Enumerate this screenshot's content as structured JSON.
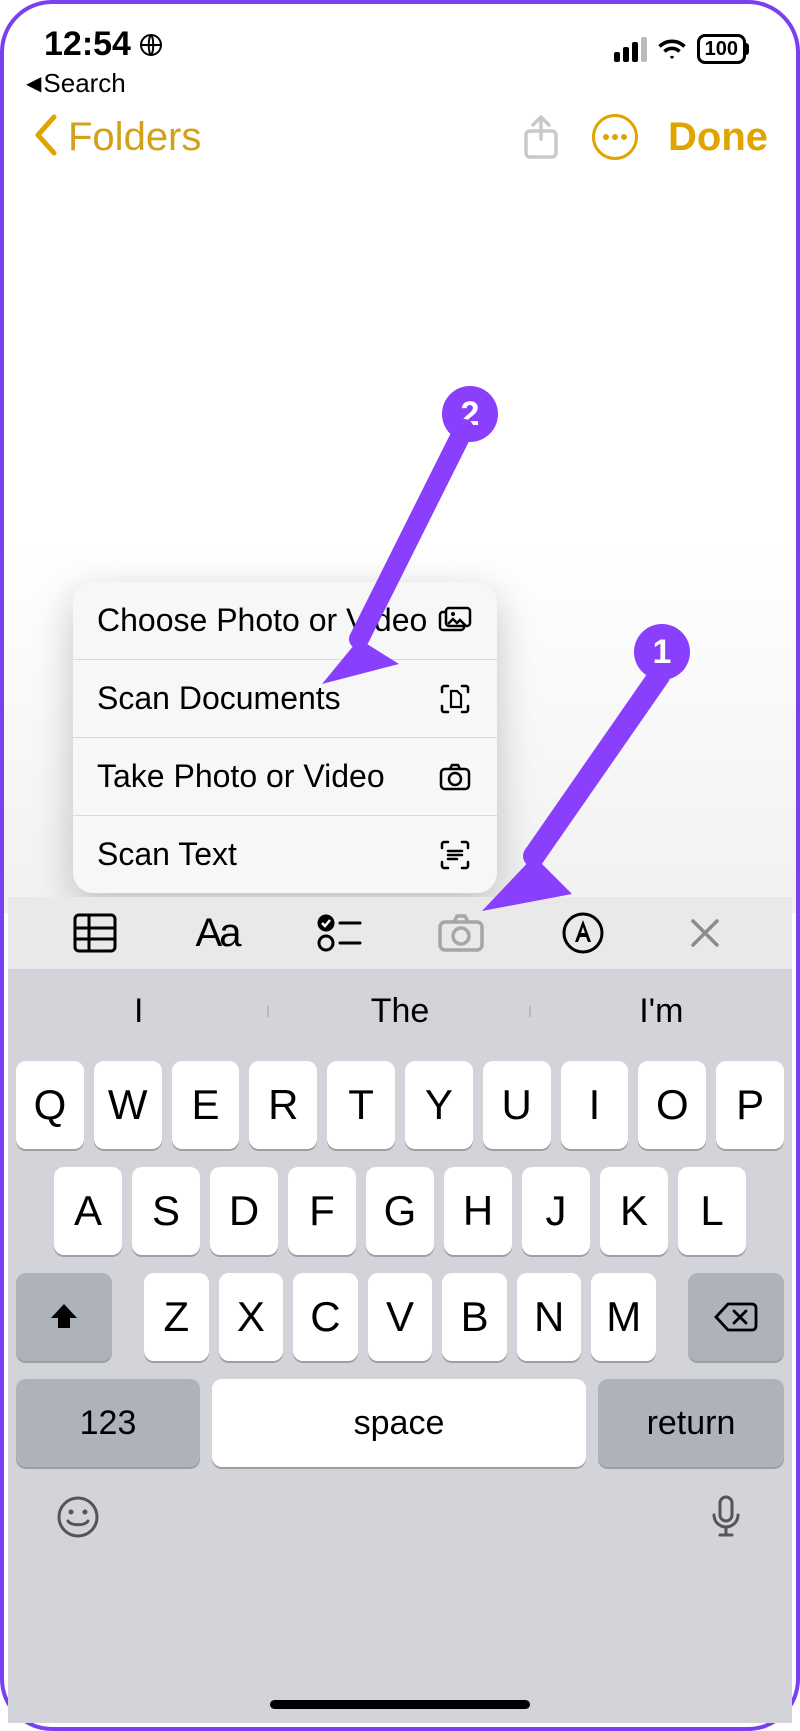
{
  "status": {
    "time": "12:54",
    "battery": "100"
  },
  "breadcrumb": {
    "label": "Search"
  },
  "nav": {
    "back_label": "Folders",
    "done_label": "Done"
  },
  "menu": {
    "items": [
      {
        "label": "Choose Photo or Video"
      },
      {
        "label": "Scan Documents"
      },
      {
        "label": "Take Photo or Video"
      },
      {
        "label": "Scan Text"
      }
    ]
  },
  "format_bar": {
    "aa": "Aa"
  },
  "predictions": [
    "I",
    "The",
    "I'm"
  ],
  "keyboard": {
    "row1": [
      "Q",
      "W",
      "E",
      "R",
      "T",
      "Y",
      "U",
      "I",
      "O",
      "P"
    ],
    "row2": [
      "A",
      "S",
      "D",
      "F",
      "G",
      "H",
      "J",
      "K",
      "L"
    ],
    "row3": [
      "Z",
      "X",
      "C",
      "V",
      "B",
      "N",
      "M"
    ],
    "num_label": "123",
    "space_label": "space",
    "return_label": "return"
  },
  "annotations": {
    "one": "1",
    "two": "2"
  }
}
